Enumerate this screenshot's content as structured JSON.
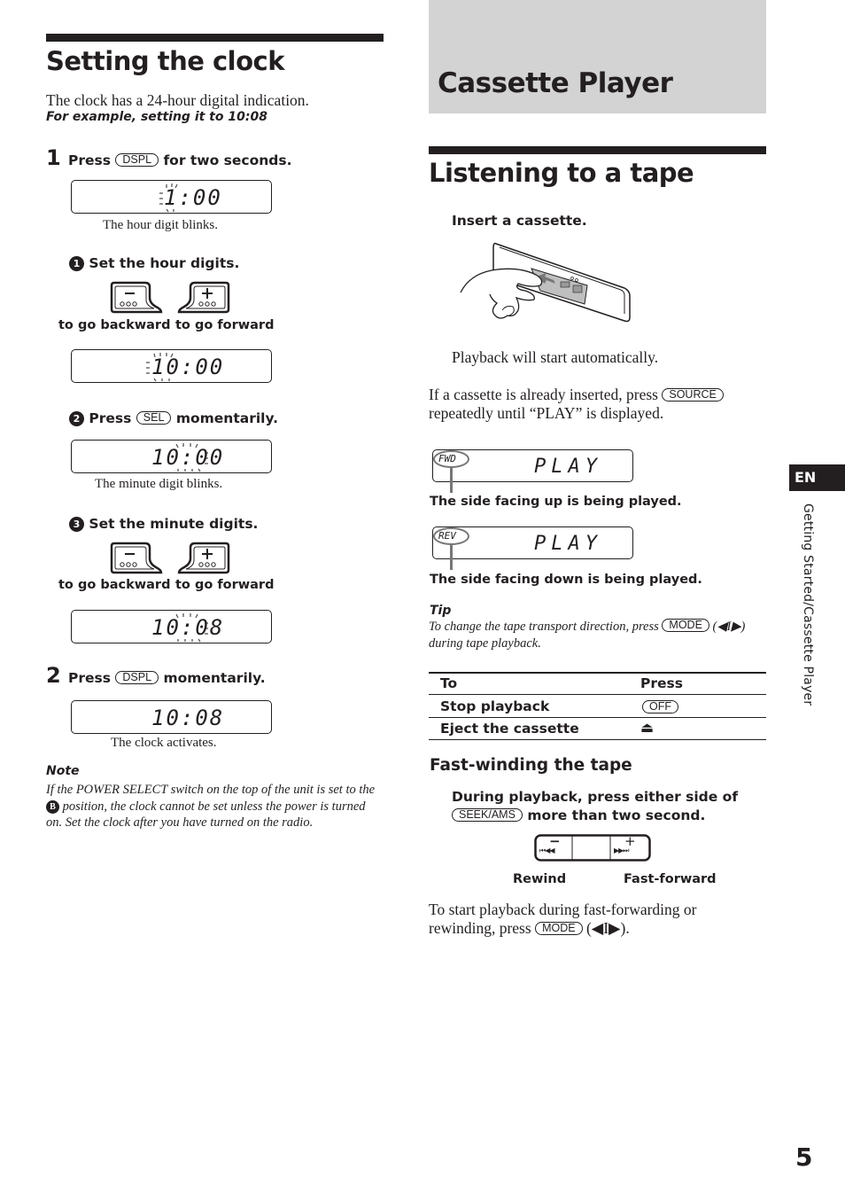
{
  "left": {
    "title": "Setting the clock",
    "intro": "The clock has a 24-hour digital indication.",
    "example": "For example, setting it to 10:08",
    "step1": {
      "number": "1",
      "press": "Press",
      "key": "DSPL",
      "suffix": "for two seconds.",
      "display": "1:00",
      "caption": "The hour digit blinks."
    },
    "substep1": {
      "marker": "1",
      "text": "Set the hour digits.",
      "back_label": "to go backward",
      "fwd_label": "to go forward",
      "minus": "−",
      "plus": "+",
      "display": "10:00"
    },
    "substep2": {
      "marker": "2",
      "press": "Press",
      "key": "SEL",
      "suffix": "momentarily.",
      "display": "10:00",
      "caption": "The minute digit blinks."
    },
    "substep3": {
      "marker": "3",
      "text": "Set the minute digits.",
      "back_label": "to go backward",
      "fwd_label": "to go forward",
      "minus": "−",
      "plus": "+",
      "display": "10:08"
    },
    "step2": {
      "number": "2",
      "press": "Press",
      "key": "DSPL",
      "suffix": "momentarily.",
      "display": "10:08",
      "caption": "The clock activates."
    },
    "note": {
      "heading": "Note",
      "text_before": "If the POWER SELECT switch on the top of the unit is set to the",
      "marker": "B",
      "text_after": "position, the clock cannot be set unless the power is turned on. Set the clock after you have turned on the radio."
    }
  },
  "right": {
    "chapter_title": "Cassette Player",
    "section_title": "Listening to a tape",
    "insert_instruction": "Insert a cassette.",
    "playback_auto": "Playback will start automatically.",
    "already_inserted": {
      "before": "If a cassette is already inserted, press",
      "key": "SOURCE",
      "after": "repeatedly until “PLAY” is displayed."
    },
    "display_fwd": {
      "indicator": "FWD",
      "text": "PLAY",
      "caption": "The side facing up is being played."
    },
    "display_rev": {
      "indicator": "REV",
      "text": "PLAY",
      "caption": "The side facing down is being played."
    },
    "tip": {
      "heading": "Tip",
      "before": "To change the tape transport direction, press",
      "key": "MODE",
      "after": "(◀I▶) during tape playback."
    },
    "table": {
      "headers": [
        "To",
        "Press"
      ],
      "rows": [
        {
          "action": "Stop playback",
          "press_key": "OFF",
          "press_icon": ""
        },
        {
          "action": "Eject the cassette",
          "press_key": "",
          "press_icon": "⏏"
        }
      ]
    },
    "fast_winding": {
      "heading": "Fast-winding the tape",
      "instr_line1": "During playback, press either side of",
      "key": "SEEK/AMS",
      "instr_line2": "more than two second.",
      "rewind_label": "Rewind",
      "ff_label": "Fast-forward",
      "minus": "−",
      "plus": "+",
      "rew_glyph": "⏮◀◀",
      "ff_glyph": "▶▶⏭",
      "resume_before": "To start playback during fast-forwarding or rewinding, press",
      "resume_key": "MODE",
      "resume_after": "(◀I▶)."
    }
  },
  "side_tab": {
    "lang": "EN",
    "section": "Getting Started/Cassette Player"
  },
  "page_number": "5",
  "colors": {
    "ink": "#231f20",
    "chapter_band": "#d3d3d3",
    "lang_tab_bg": "#231f20",
    "lang_tab_text": "#ffffff"
  }
}
